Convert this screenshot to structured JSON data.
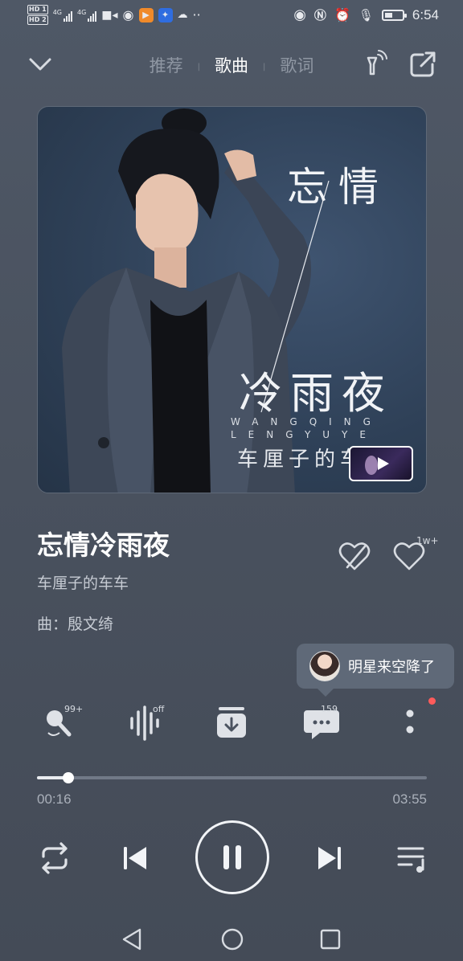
{
  "status_bar": {
    "sim1": "HD 1",
    "sim2": "HD 2",
    "net1": "4G",
    "net2": "4G",
    "time": "6:54"
  },
  "header": {
    "tabs": [
      {
        "label": "推荐",
        "active": false
      },
      {
        "label": "歌曲",
        "active": true
      },
      {
        "label": "歌词",
        "active": false
      }
    ]
  },
  "album": {
    "title_line1": "忘情",
    "title_line2": "冷雨夜",
    "latin_line1": "WANGQING",
    "latin_line2": "LENGYUYE",
    "artist_text": "车厘子的车车"
  },
  "song": {
    "title": "忘情冷雨夜",
    "artist": "车厘子的车车",
    "composer": "曲：殷文绮",
    "like_count": "1w+"
  },
  "star_bubble": {
    "text": "明星来空降了"
  },
  "actions": {
    "sing_badge": "99+",
    "effect_badge": "off",
    "comment_count": "159"
  },
  "progress": {
    "current": "00:16",
    "total": "03:55",
    "fraction": 0.08
  },
  "colors": {
    "background": "#4b5360",
    "accent": "#ffffff",
    "notification_dot": "#ff5b5b"
  }
}
